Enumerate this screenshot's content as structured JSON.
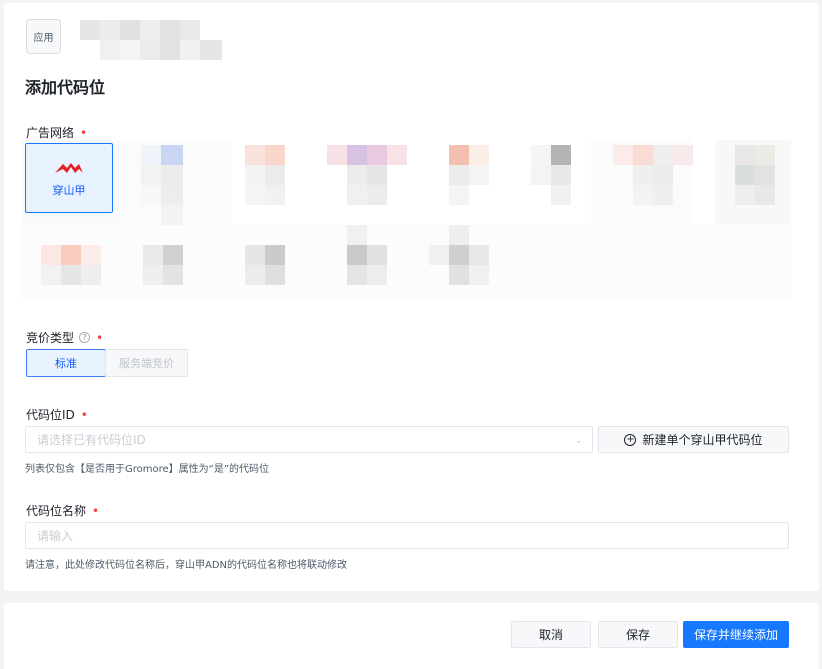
{
  "app": {
    "badge": "应用"
  },
  "page": {
    "title": "添加代码位"
  },
  "ad_network": {
    "label": "广告网络",
    "required_mark": "•",
    "selected": {
      "name": "穿山甲",
      "icon": "pangle-logo-icon",
      "brand_color": "#e02424"
    }
  },
  "bidding": {
    "label": "竞价类型",
    "help": "?",
    "required_mark": "•",
    "options": [
      "标准",
      "服务端竞价"
    ],
    "selected": "标准"
  },
  "slot_id": {
    "label": "代码位ID",
    "required_mark": "•",
    "placeholder": "请选择已有代码位ID",
    "new_button": "新建单个穿山甲代码位",
    "hint": "列表仅包含【是否用于Gromore】属性为“是”的代码位"
  },
  "slot_name": {
    "label": "代码位名称",
    "required_mark": "•",
    "placeholder": "请输入",
    "hint": "请注意，此处修改代码位名称后，穿山甲ADN的代码位名称也将联动修改"
  },
  "footer": {
    "cancel": "取消",
    "save": "保存",
    "save_continue": "保存并继续添加"
  },
  "colors": {
    "primary": "#1677ff",
    "required": "#f53f3f",
    "background": "#f2f3f5"
  }
}
